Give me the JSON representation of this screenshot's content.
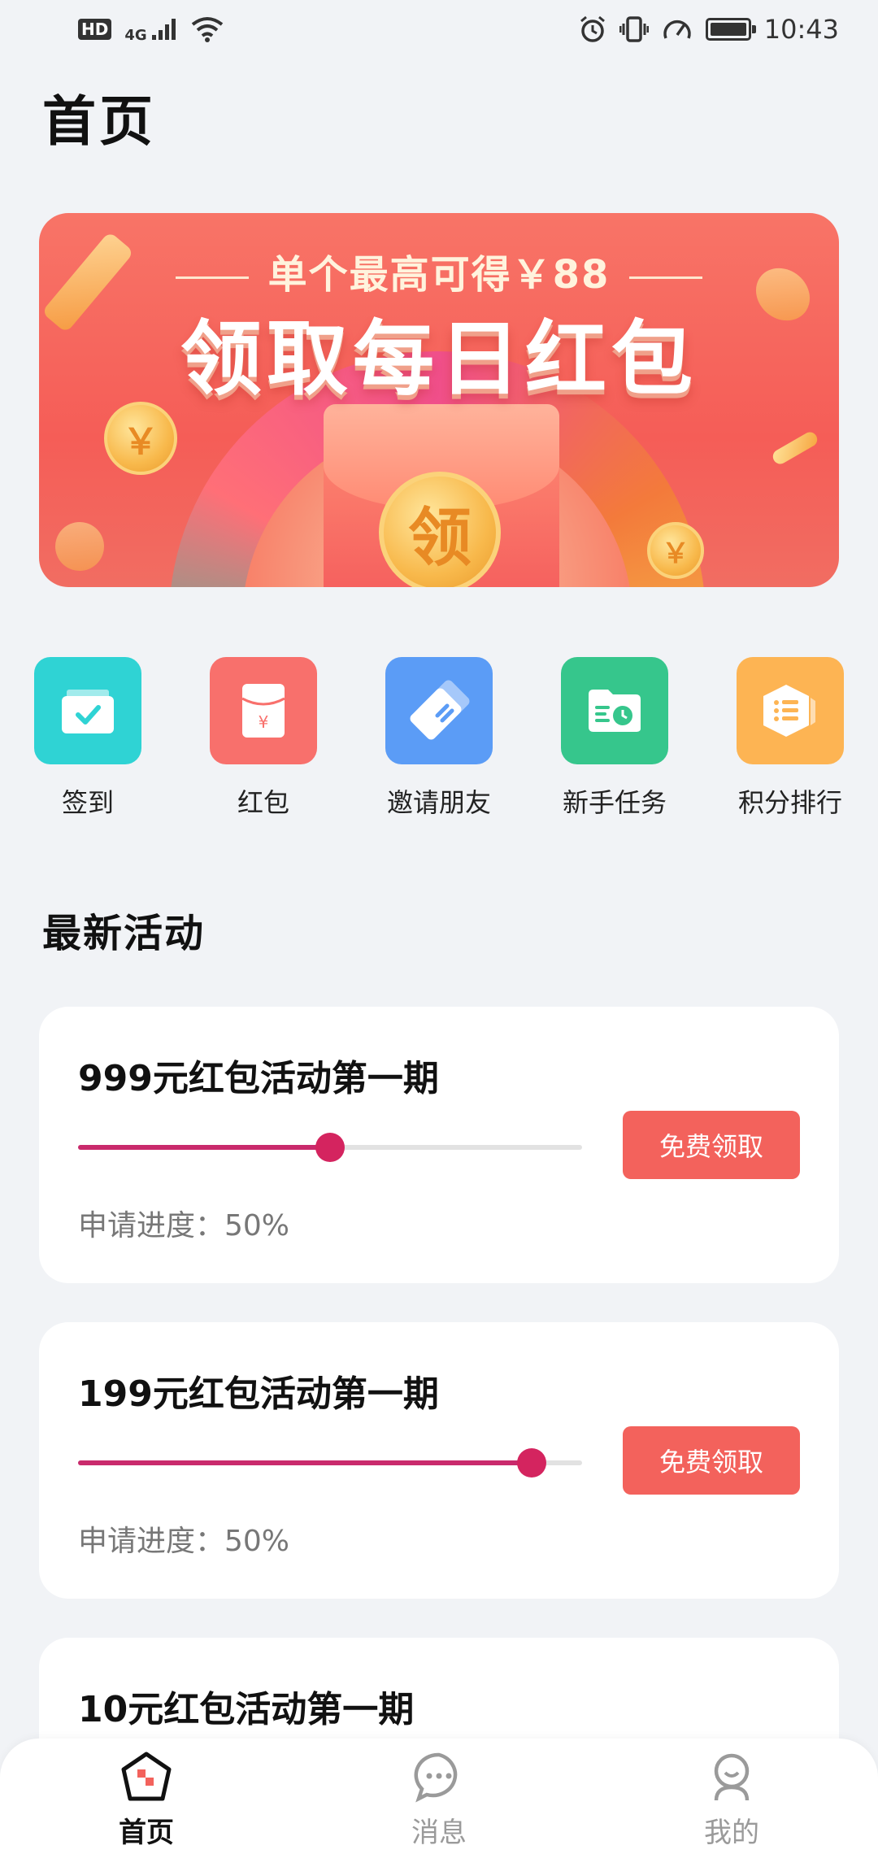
{
  "status_bar": {
    "hd": "HD",
    "network": "4G",
    "time": "10:43"
  },
  "page": {
    "title": "首页"
  },
  "banner": {
    "subtitle": "单个最高可得￥88",
    "title": "领取每日红包",
    "coin_text": "领",
    "small_coin_text": "￥"
  },
  "quick_actions": [
    {
      "label": "签到",
      "icon": "checkin-icon"
    },
    {
      "label": "红包",
      "icon": "red-envelope-icon"
    },
    {
      "label": "邀请朋友",
      "icon": "invite-card-icon"
    },
    {
      "label": "新手任务",
      "icon": "task-folder-icon"
    },
    {
      "label": "积分排行",
      "icon": "ranking-list-icon"
    }
  ],
  "section": {
    "title": "最新活动"
  },
  "activities": [
    {
      "title": "999元红包活动第一期",
      "progress_text": "申请进度：50%",
      "slider_fraction": 0.5,
      "button_label": "免费领取"
    },
    {
      "title": "199元红包活动第一期",
      "progress_text": "申请进度：50%",
      "slider_fraction": 0.9,
      "button_label": "免费领取"
    },
    {
      "title": "10元红包活动第一期"
    }
  ],
  "tab_bar": {
    "items": [
      {
        "label": "首页",
        "icon": "home-icon",
        "active": true
      },
      {
        "label": "消息",
        "icon": "message-icon",
        "active": false
      },
      {
        "label": "我的",
        "icon": "profile-icon",
        "active": false
      }
    ]
  },
  "colors": {
    "accent_red": "#f3625c",
    "slider": "#c92a6c",
    "background": "#f1f3f6"
  }
}
